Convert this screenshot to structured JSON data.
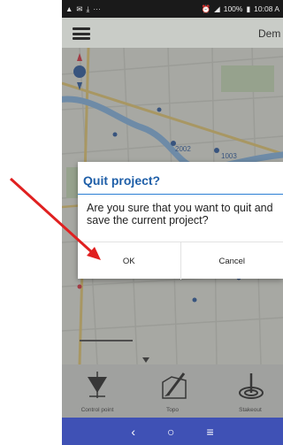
{
  "status_bar": {
    "time": "10:08 A",
    "battery": "100%",
    "left_icons": [
      "warning-icon",
      "mail-icon",
      "download-icon",
      "more-icon"
    ],
    "right_icons": [
      "alarm-icon",
      "bluetooth-icon",
      "nfc-icon",
      "mute-icon",
      "wifi-icon",
      "signal-icon",
      "battery-icon"
    ]
  },
  "app_bar": {
    "title": "Dem"
  },
  "dialog": {
    "title": "Quit project?",
    "message": "Are you sure that you want to quit and save the current project?",
    "ok_label": "OK",
    "cancel_label": "Cancel"
  },
  "map": {
    "labels": [
      "2002",
      "1003"
    ]
  },
  "toolbar": {
    "items": [
      {
        "label": "Control point",
        "icon": "control-point-icon"
      },
      {
        "label": "Topo",
        "icon": "topo-icon"
      },
      {
        "label": "Stakeout",
        "icon": "stakeout-icon"
      }
    ]
  },
  "navbar": {
    "back": "‹",
    "home": "○",
    "recents": "≡"
  },
  "colors": {
    "accent": "#1f5fa8",
    "navbar": "#3f51b5",
    "annotation_arrow": "#e02020"
  }
}
